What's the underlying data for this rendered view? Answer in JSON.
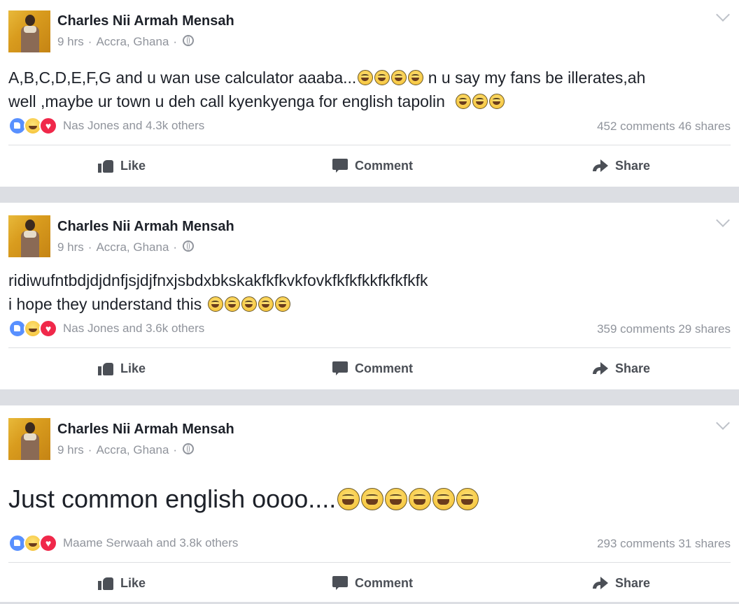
{
  "posts": [
    {
      "author": "Charles Nii Armah Mensah",
      "time": "9 hrs",
      "location": "Accra, Ghana",
      "text_lines": [
        "A,B,C,D,E,F,G and u wan use calculator aaaba...",
        " n u say my fans be illerates,ah",
        "well ,maybe ur town u deh call kyenkyenga for english tapolin"
      ],
      "reactions_text": "Nas Jones and 4.3k others",
      "comments": "452 comments",
      "shares": "46 shares",
      "actions": {
        "like": "Like",
        "comment": "Comment",
        "share": "Share"
      }
    },
    {
      "author": "Charles Nii Armah Mensah",
      "time": "9 hrs",
      "location": "Accra, Ghana",
      "text_lines": [
        "ridiwufntbdjdjdnfjsjdjfnxjsbdxbkskakfkfkvkfovkfkfkfkkfkfkfkfk",
        "i hope they understand this"
      ],
      "reactions_text": "Nas Jones and 3.6k others",
      "comments": "359 comments",
      "shares": "29 shares",
      "actions": {
        "like": "Like",
        "comment": "Comment",
        "share": "Share"
      }
    },
    {
      "author": "Charles Nii Armah Mensah",
      "time": "9 hrs",
      "location": "Accra, Ghana",
      "text_lines": [
        "Just common english oooo...."
      ],
      "reactions_text": "Maame Serwaah and 3.8k others",
      "comments": "293 comments",
      "shares": "31 shares",
      "actions": {
        "like": "Like",
        "comment": "Comment",
        "share": "Share"
      }
    }
  ],
  "icons": [
    "globe-icon",
    "chevron-down-icon",
    "like-reaction-icon",
    "haha-reaction-icon",
    "love-reaction-icon",
    "like-icon",
    "comment-icon",
    "share-icon",
    "tears-of-joy-emoji"
  ],
  "colors": {
    "background": "#dcdee3",
    "card": "#ffffff",
    "meta_text": "#90949c",
    "action_text": "#4b4f56",
    "like_blue": "#5890ff",
    "love_red": "#f0284a"
  }
}
